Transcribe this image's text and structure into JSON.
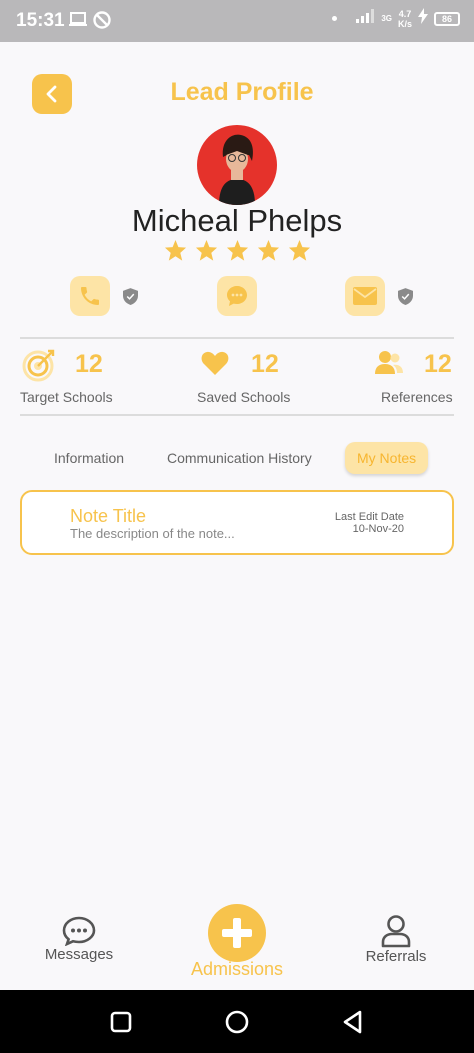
{
  "status_bar": {
    "time": "15:31",
    "network_type": "3G",
    "speed_value": "4.7",
    "speed_unit": "K/s",
    "battery": "86"
  },
  "header": {
    "title": "Lead Profile",
    "back_icon": "chevron-left-icon"
  },
  "profile": {
    "name": "Micheal Phelps",
    "rating": 5,
    "rating_max": 5
  },
  "contact_actions": [
    {
      "icon": "phone-icon",
      "verified": true
    },
    {
      "icon": "chat-icon",
      "verified": false
    },
    {
      "icon": "mail-icon",
      "verified": true
    }
  ],
  "stats": [
    {
      "icon": "target-icon",
      "value": "12",
      "label": "Target Schools"
    },
    {
      "icon": "heart-icon",
      "value": "12",
      "label": "Saved Schools"
    },
    {
      "icon": "people-icon",
      "value": "12",
      "label": "References"
    }
  ],
  "tabs": [
    {
      "label": "Information",
      "active": false
    },
    {
      "label": "Communication History",
      "active": false
    },
    {
      "label": "My Notes",
      "active": true
    }
  ],
  "notes": [
    {
      "title": "Note Title",
      "description": "The description of the note...",
      "date_label": "Last Edit Date",
      "date": "10-Nov-20"
    }
  ],
  "bottom_nav": {
    "left": {
      "label": "Messages",
      "icon": "chat-bubble-icon"
    },
    "center": {
      "label": "Admissions",
      "icon": "plus-icon"
    },
    "right": {
      "label": "Referrals",
      "icon": "user-icon"
    }
  },
  "colors": {
    "accent": "#f7c34c",
    "accent_light": "#fde4a6",
    "avatar_bg": "#e5322b"
  }
}
